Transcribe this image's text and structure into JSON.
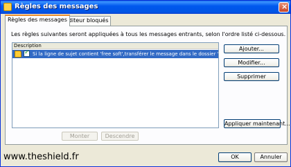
{
  "window": {
    "title": "Règles des messages"
  },
  "tabs": [
    {
      "label": "Règles des messages"
    },
    {
      "label": "Expéditeur bloqués"
    }
  ],
  "intro_text": "Les règles suivantes seront appliquées à tous les messages entrants, selon l'ordre listé ci-dessous.",
  "rules_list": {
    "header": "Description",
    "rows": [
      {
        "checked": true,
        "check_mark": "✓",
        "text": "Si la ligne de sujet contient 'free soft',transférer le message dans le dossier 'Eléments supprimés'."
      }
    ]
  },
  "buttons": {
    "add": "Ajouter...",
    "modify": "Modifier...",
    "delete": "Supprimer",
    "apply_now": "Appliquer maintenant...",
    "move_up": "Monter",
    "move_down": "Descendre",
    "ok": "OK",
    "cancel": "Annuler"
  },
  "watermark": "www.theshield.fr",
  "icons": {
    "title": "rules-app-icon",
    "close": "close-icon",
    "rule": "rule-icon",
    "check": "checkbox-checked-icon"
  },
  "colors": {
    "titlebar": "#0058ee",
    "selection": "#316ac5",
    "window_bg": "#ece9d8",
    "active_tab_accent": "#e68b2c"
  }
}
